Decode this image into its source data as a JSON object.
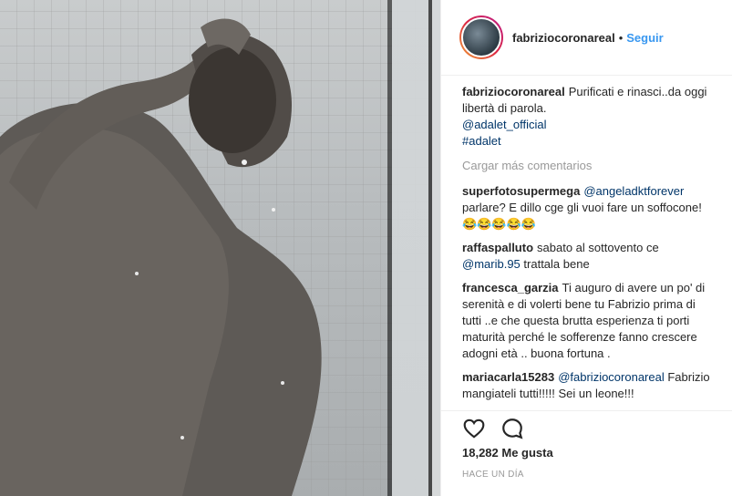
{
  "post": {
    "image_alt": "post-photo"
  },
  "header": {
    "username": "fabriziocoronareal",
    "separator": "•",
    "follow_label": "Seguir"
  },
  "caption": {
    "username": "fabriziocoronareal",
    "text": "Purificati e rinasci..da oggi libertà di parola.",
    "mention": "@adalet_official",
    "hashtag": "#adalet"
  },
  "load_more_label": "Cargar más comentarios",
  "comments": [
    {
      "user": "superfotosupermega",
      "mention": "@angeladktforever",
      "text": "parlare? E dillo cge gli vuoi fare un soffocone! 😂😂😂😂😂"
    },
    {
      "user": "raffaspalluto",
      "text_before": "sabato al sottovento ce",
      "mention": "@marib.95",
      "text": "trattala bene"
    },
    {
      "user": "francesca_garzia",
      "text": "Ti auguro di avere un po' di serenità e di volerti bene tu Fabrizio prima di tutti ..e che questa brutta esperienza ti porti maturità perché le sofferenze fanno crescere adogni età .. buona fortuna ."
    },
    {
      "user": "mariacarla15283",
      "mention": "@fabriziocoronareal",
      "text": "Fabrizio mangiateli tutti!!!!! Sei un leone!!!"
    }
  ],
  "actions": {
    "like_icon": "heart-icon",
    "comment_icon": "comment-icon"
  },
  "likes_text": "18,282 Me gusta",
  "timestamp": "HACE UN DÍA"
}
